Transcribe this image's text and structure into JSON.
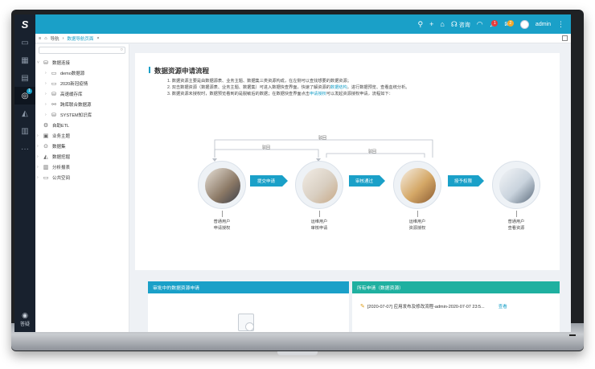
{
  "app": {
    "logo": "S",
    "user": "admin",
    "consult_label": "咨询",
    "notif_count": "1",
    "msg_count": "2"
  },
  "tabs": {
    "nav_label": "导航",
    "active_tab": "数据导航页面",
    "close": "×"
  },
  "sidebar": {
    "bottom_label": "答疑"
  },
  "tree": {
    "items": [
      {
        "label": "数据连接",
        "icon": "database-icon",
        "expanded": true
      },
      {
        "label": "demo数据源",
        "icon": "folder-icon"
      },
      {
        "label": "2020新冠疫情",
        "icon": "folder-icon"
      },
      {
        "label": "高速缓存库",
        "icon": "database-icon"
      },
      {
        "label": "跨库联合数据源",
        "icon": "link-icon"
      },
      {
        "label": "SYSTEM知识库",
        "icon": "database-icon"
      },
      {
        "label": "自助ETL",
        "icon": "etl-icon"
      },
      {
        "label": "业务主题",
        "icon": "topic-icon"
      },
      {
        "label": "数据集",
        "icon": "dataset-icon"
      },
      {
        "label": "数据挖掘",
        "icon": "mining-icon"
      },
      {
        "label": "分析报表",
        "icon": "report-icon"
      },
      {
        "label": "公共空间",
        "icon": "folder-icon"
      }
    ]
  },
  "main": {
    "title": "数据资源申请流程",
    "desc": [
      {
        "pre": "1. 数据资源主要是由数据源表、业务主题、数据集三类资源构成，在左侧可以查找想要的数据资源；",
        "hl": "",
        "post": ""
      },
      {
        "pre": "2. 双击数据资源（数据源表、业务主题、数据集）可进入数据快查界面，快速了解资源的",
        "hl": "数据结构",
        "post": "，进行数据预览、查看血统分析。"
      },
      {
        "pre": "3. 数据资源未授权时，数据预览看到的是脱敏后的数据；在数据快查界面点击",
        "hl": "申请授权",
        "post": "可以发起资源授权申请，流程如下："
      }
    ],
    "flow": {
      "back_labels": [
        "驳回",
        "驳回",
        "驳回"
      ],
      "arrows": [
        "提交申请",
        "审核通过",
        "授予权限"
      ],
      "steps": [
        {
          "role": "普通用户",
          "action": "申请授权"
        },
        {
          "role": "运维用户",
          "action": "审核申请"
        },
        {
          "role": "运维用户",
          "action": "资源授权"
        },
        {
          "role": "普通用户",
          "action": "查看资源"
        }
      ]
    }
  },
  "panels": {
    "pending_title": "审批中的数据资源申请",
    "all_title": "所有申请（数据资源）",
    "request_item": "[2020-07-07] 应用发布及修改流程-admin-2020-07-07 23:5...",
    "view_label": "查看"
  }
}
